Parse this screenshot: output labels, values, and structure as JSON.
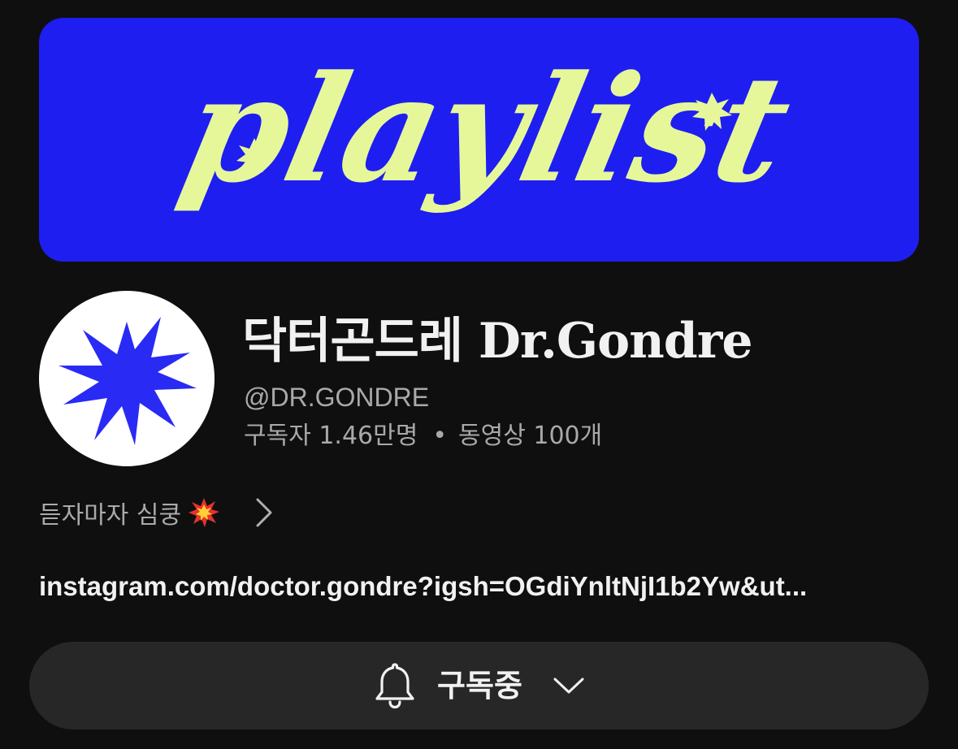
{
  "banner": {
    "word": "playlist",
    "background_color": "#1e1ef0",
    "ink_color": "#e6f79a"
  },
  "channel": {
    "name_korean": "닥터곤드레",
    "name_latin": "Dr.Gondre",
    "handle": "@DR.GONDRE",
    "subscribers_label": "구독자 1.46만명",
    "separator": "•",
    "videos_label": "동영상 100개",
    "avatar_icon": "starburst-icon",
    "avatar_color": "#2a2af5"
  },
  "description": {
    "text": "듣자마자 심쿵",
    "emoji_icon": "collision-icon",
    "more_icon": "chevron-right-icon"
  },
  "link": {
    "text": "instagram.com/doctor.gondre?igsh=OGdiYnltNjI1b2Yw&ut..."
  },
  "subscribe": {
    "label": "구독중",
    "bell_icon": "bell-icon",
    "dropdown_icon": "chevron-down-icon"
  }
}
